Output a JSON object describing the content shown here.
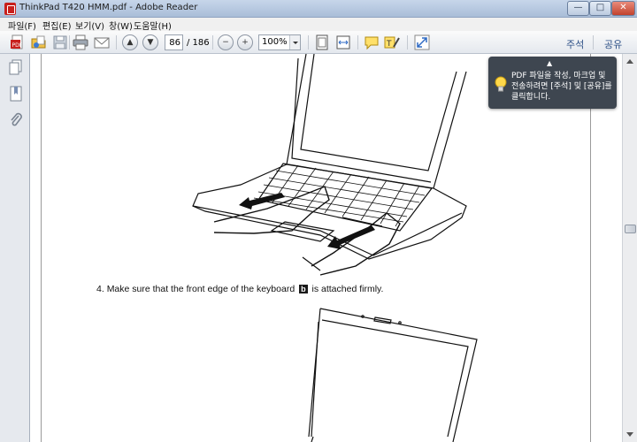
{
  "window": {
    "title": "ThinkPad T420 HMM.pdf - Adobe Reader",
    "min_label": "—",
    "max_label": "□",
    "close_label": "✕"
  },
  "menu": {
    "items": [
      "파일(F)",
      "편집(E)",
      "보기(V)",
      "창(W)",
      "도움말(H)"
    ]
  },
  "toolbar": {
    "page_current": "86",
    "page_total": "/ 186",
    "zoom": "100%",
    "comment_label": "주석",
    "share_label": "공유",
    "icons": [
      "create-pdf-icon",
      "open-file-icon",
      "save-icon",
      "print-icon",
      "email-icon",
      "prev-page-icon",
      "next-page-icon",
      "zoom-out-icon",
      "zoom-in-icon",
      "fit-page-icon",
      "fit-width-icon",
      "comment-icon",
      "highlight-icon",
      "fullscreen-icon"
    ]
  },
  "nav": {
    "icons": [
      "pages-icon",
      "bookmarks-icon",
      "attachments-icon"
    ]
  },
  "document": {
    "step_number": "4.",
    "caption_before": "Make sure that the front edge of the keyboard",
    "callout_letter": "b",
    "caption_after": "is attached firmly."
  },
  "tooltip": {
    "text": "PDF 파일을 작성, 마크업 및 전송하려면 [주석] 및 [공유]를 클릭합니다."
  },
  "colors": {
    "title_bar": "#b7c9e0",
    "close_button": "#c2432e",
    "tooltip_bg": "#3e4650",
    "link_blue": "#2c4f86"
  }
}
